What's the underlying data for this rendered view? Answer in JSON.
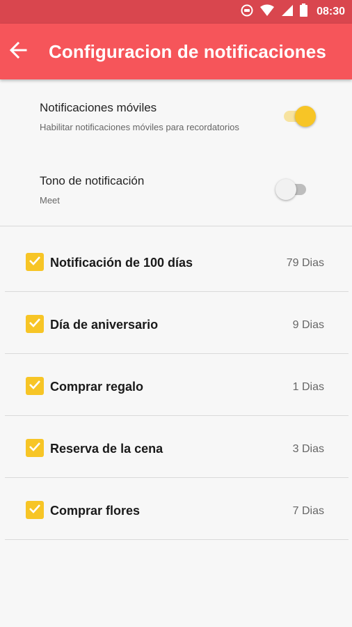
{
  "colors": {
    "statusbar": "#d9464e",
    "appbar": "#f6555a",
    "accent": "#f7c526",
    "background": "#f7f7f7"
  },
  "statusbar": {
    "time": "08:30",
    "icons": [
      "cast-icon",
      "wifi-icon",
      "signal-icon",
      "battery-icon"
    ]
  },
  "appbar": {
    "back_icon": "arrow-back-icon",
    "title": "Configuracion de notificaciones"
  },
  "settings": [
    {
      "label": "Notificaciones móviles",
      "subtitle": "Habilitar notificaciones móviles para recordatorios",
      "enabled": true
    },
    {
      "label": "Tono de notificación",
      "subtitle": "Meet",
      "enabled": false
    }
  ],
  "reminders": [
    {
      "label": "Notificación de 100 días",
      "days": "79 Dias",
      "checked": true
    },
    {
      "label": "Día de aniversario",
      "days": "9 Dias",
      "checked": true
    },
    {
      "label": "Comprar regalo",
      "days": "1 Dias",
      "checked": true
    },
    {
      "label": "Reserva de la cena",
      "days": "3 Dias",
      "checked": true
    },
    {
      "label": "Comprar flores",
      "days": "7 Dias",
      "checked": true
    }
  ]
}
